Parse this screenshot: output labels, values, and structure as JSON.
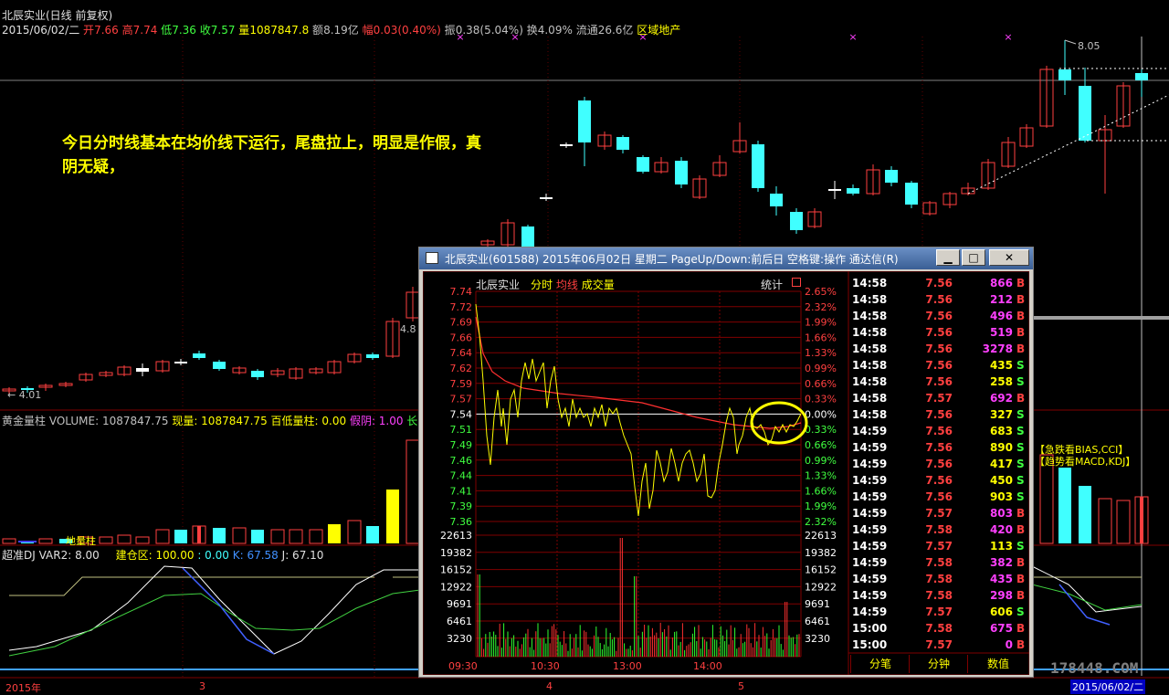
{
  "header": {
    "title": "北辰实业(日线 前复权)",
    "date": "2015/06/02/二",
    "open_label": "开",
    "open": "7.66",
    "high_label": "高",
    "high": "7.74",
    "low_label": "低",
    "low": "7.36",
    "close_label": "收",
    "close": "7.57",
    "vol_label": "量",
    "vol": "1087847.8",
    "amt_label": "额",
    "amt": "8.19亿",
    "chg_label": "幅",
    "chg": "0.03(0.40%)",
    "amp_label": "振",
    "amp": "0.38(5.04%)",
    "turn_label": "换",
    "turn": "4.09%",
    "float_label": "流通",
    "float": "26.6亿",
    "sector": "区域地产"
  },
  "annotation": "今日分时线基本在均价线下运行，尾盘拉上，明显是作假，真阴无疑，",
  "price_labels": {
    "high": "8.05",
    "mid": "4.8",
    "low": "4.01"
  },
  "volume_bar": {
    "title": "黄金量柱",
    "volume": "VOLUME: 1087847.75",
    "now": "现量: 1087847.75",
    "hilo": "百低量柱: 0.00",
    "fake": "假阴: 1.00",
    "long": "长阴",
    "bottom": "地量柱"
  },
  "kdj": {
    "title": "超准DJ",
    "var2": "VAR2: 8.00",
    "build": "建仓区: 100.00",
    "dot": ": 0.00",
    "k": "K: 67.58",
    "j": "J: 67.10"
  },
  "signals": [
    "【急跌看BIAS,CCI】",
    "【趋势看MACD,KDJ】"
  ],
  "time_axis": [
    "2015年",
    "3",
    "4",
    "5"
  ],
  "date_box": "2015/06/02/二",
  "watermark": "178448.COM",
  "window": {
    "title": "北辰实业(601588) 2015年06月02日 星期二 PageUp/Down:前后日 空格键:操作 通达信(R)",
    "min": "▁",
    "max": "□",
    "close": "✕",
    "stock": "北辰实业",
    "legend": [
      "分时",
      "均线",
      "成交量"
    ],
    "stat": "统计",
    "prices": [
      "7.74",
      "7.72",
      "7.69",
      "7.66",
      "7.64",
      "7.62",
      "7.59",
      "7.57",
      "7.54",
      "7.51",
      "7.49",
      "7.46",
      "7.44",
      "7.41",
      "7.39",
      "7.36"
    ],
    "pcts": [
      "2.65%",
      "2.32%",
      "1.99%",
      "1.66%",
      "1.33%",
      "0.99%",
      "0.66%",
      "0.33%",
      "0.00%",
      "0.33%",
      "0.66%",
      "0.99%",
      "1.33%",
      "1.66%",
      "1.99%",
      "2.32%"
    ],
    "vols": [
      "22613",
      "19382",
      "16152",
      "12922",
      "9691",
      "6461",
      "3230"
    ],
    "times": [
      "09:30",
      "10:30",
      "13:00",
      "14:00"
    ],
    "tabs": [
      "分笔",
      "分钟",
      "数值"
    ]
  },
  "ticks": [
    {
      "time": "14:58",
      "price": "7.56",
      "vol": "866",
      "side": "B"
    },
    {
      "time": "14:58",
      "price": "7.56",
      "vol": "212",
      "side": "B"
    },
    {
      "time": "14:58",
      "price": "7.56",
      "vol": "496",
      "side": "B"
    },
    {
      "time": "14:58",
      "price": "7.56",
      "vol": "519",
      "side": "B"
    },
    {
      "time": "14:58",
      "price": "7.56",
      "vol": "3278",
      "side": "B"
    },
    {
      "time": "14:58",
      "price": "7.56",
      "vol": "435",
      "side": "S"
    },
    {
      "time": "14:58",
      "price": "7.56",
      "vol": "258",
      "side": "S"
    },
    {
      "time": "14:58",
      "price": "7.57",
      "vol": "692",
      "side": "B"
    },
    {
      "time": "14:58",
      "price": "7.56",
      "vol": "327",
      "side": "S"
    },
    {
      "time": "14:59",
      "price": "7.56",
      "vol": "683",
      "side": "S"
    },
    {
      "time": "14:59",
      "price": "7.56",
      "vol": "890",
      "side": "S"
    },
    {
      "time": "14:59",
      "price": "7.56",
      "vol": "417",
      "side": "S"
    },
    {
      "time": "14:59",
      "price": "7.56",
      "vol": "450",
      "side": "S"
    },
    {
      "time": "14:59",
      "price": "7.56",
      "vol": "903",
      "side": "S"
    },
    {
      "time": "14:59",
      "price": "7.57",
      "vol": "803",
      "side": "B"
    },
    {
      "time": "14:59",
      "price": "7.58",
      "vol": "420",
      "side": "B"
    },
    {
      "time": "14:59",
      "price": "7.57",
      "vol": "113",
      "side": "S"
    },
    {
      "time": "14:59",
      "price": "7.58",
      "vol": "382",
      "side": "B"
    },
    {
      "time": "14:59",
      "price": "7.58",
      "vol": "435",
      "side": "B"
    },
    {
      "time": "14:59",
      "price": "7.58",
      "vol": "298",
      "side": "B"
    },
    {
      "time": "14:59",
      "price": "7.57",
      "vol": "606",
      "side": "S"
    },
    {
      "time": "15:00",
      "price": "7.58",
      "vol": "675",
      "side": "B"
    },
    {
      "time": "15:00",
      "price": "7.57",
      "vol": "0",
      "side": "B"
    }
  ],
  "colors": {
    "up": "#ff4040",
    "down": "#40ffff",
    "avg": "#ffff00",
    "grid": "#800000"
  }
}
